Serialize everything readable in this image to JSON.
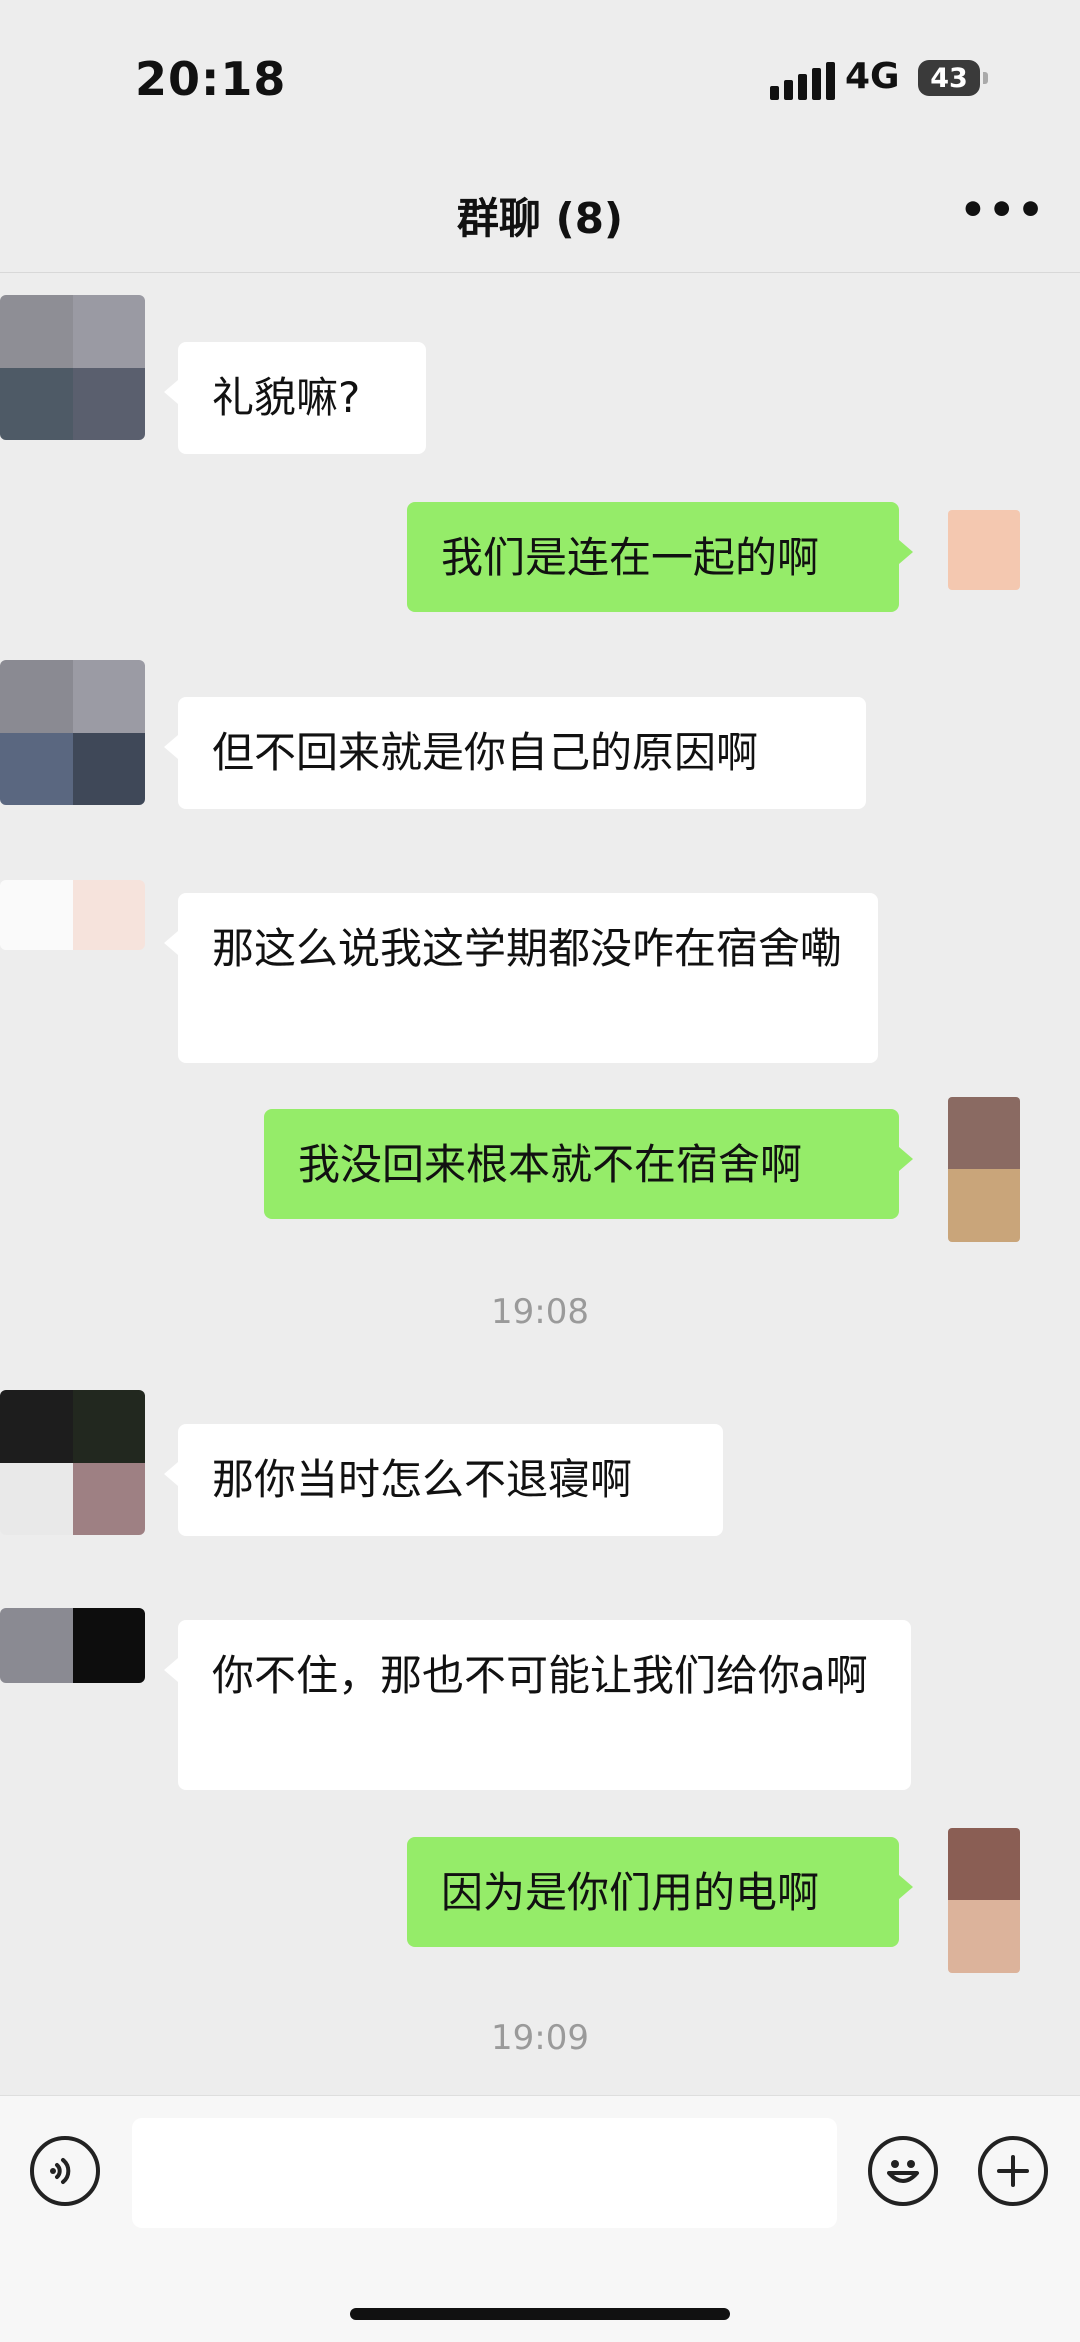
{
  "status_bar": {
    "time": "20:18",
    "network": "4G",
    "battery": "43"
  },
  "header": {
    "title": "群聊 (8)",
    "more_icon": "more-dots-icon"
  },
  "messages": [
    {
      "side": "left",
      "text": "礼貌嘛?"
    },
    {
      "side": "right",
      "text": "我们是连在一起的啊"
    },
    {
      "side": "left",
      "text": "但不回来就是你自己的原因啊"
    },
    {
      "side": "left",
      "text": "那这么说我这学期都没咋在宿舍嘞"
    },
    {
      "side": "right",
      "text": "我没回来根本就不在宿舍啊"
    },
    {
      "side": "left",
      "text": "那你当时怎么不退寝啊"
    },
    {
      "side": "left",
      "text": "你不住，那也不可能让我们给你a啊"
    },
    {
      "side": "right",
      "text": "因为是你们用的电啊"
    }
  ],
  "timestamps": [
    "19:08",
    "19:09"
  ],
  "input_bar": {
    "voice_icon": "voice-icon",
    "emoji_icon": "emoji-icon",
    "add_icon": "plus-icon",
    "text_value": ""
  },
  "colors": {
    "background": "#EDEDED",
    "sent_bubble": "#95EC69",
    "received_bubble": "#FFFFFF"
  }
}
